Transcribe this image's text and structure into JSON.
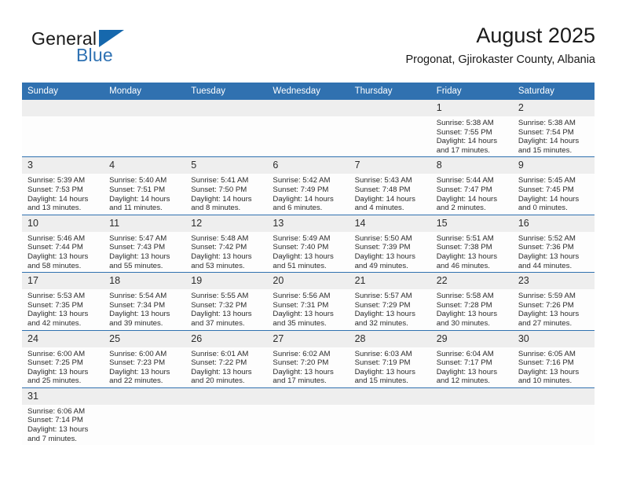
{
  "brand": {
    "name_part1": "General",
    "name_part2": "Blue",
    "logo_icon": "triangle-logo-icon"
  },
  "header": {
    "title": "August 2025",
    "subtitle": "Progonat, Gjirokaster County, Albania"
  },
  "colors": {
    "header_blue": "#3071b0",
    "brand_blue": "#2f72b3",
    "daynum_bg": "#eeeeee",
    "cell_bg": "#fdfdfd",
    "text": "#2b2b2b"
  },
  "weekday_headers": [
    "Sunday",
    "Monday",
    "Tuesday",
    "Wednesday",
    "Thursday",
    "Friday",
    "Saturday"
  ],
  "weeks": [
    [
      {
        "day": "",
        "blank": true,
        "sunrise": "",
        "sunset": "",
        "daylight_line1": "",
        "daylight_line2": ""
      },
      {
        "day": "",
        "blank": true,
        "sunrise": "",
        "sunset": "",
        "daylight_line1": "",
        "daylight_line2": ""
      },
      {
        "day": "",
        "blank": true,
        "sunrise": "",
        "sunset": "",
        "daylight_line1": "",
        "daylight_line2": ""
      },
      {
        "day": "",
        "blank": true,
        "sunrise": "",
        "sunset": "",
        "daylight_line1": "",
        "daylight_line2": ""
      },
      {
        "day": "",
        "blank": true,
        "sunrise": "",
        "sunset": "",
        "daylight_line1": "",
        "daylight_line2": ""
      },
      {
        "day": "1",
        "sunrise": "Sunrise: 5:38 AM",
        "sunset": "Sunset: 7:55 PM",
        "daylight_line1": "Daylight: 14 hours",
        "daylight_line2": "and 17 minutes."
      },
      {
        "day": "2",
        "sunrise": "Sunrise: 5:38 AM",
        "sunset": "Sunset: 7:54 PM",
        "daylight_line1": "Daylight: 14 hours",
        "daylight_line2": "and 15 minutes."
      }
    ],
    [
      {
        "day": "3",
        "sunrise": "Sunrise: 5:39 AM",
        "sunset": "Sunset: 7:53 PM",
        "daylight_line1": "Daylight: 14 hours",
        "daylight_line2": "and 13 minutes."
      },
      {
        "day": "4",
        "sunrise": "Sunrise: 5:40 AM",
        "sunset": "Sunset: 7:51 PM",
        "daylight_line1": "Daylight: 14 hours",
        "daylight_line2": "and 11 minutes."
      },
      {
        "day": "5",
        "sunrise": "Sunrise: 5:41 AM",
        "sunset": "Sunset: 7:50 PM",
        "daylight_line1": "Daylight: 14 hours",
        "daylight_line2": "and 8 minutes."
      },
      {
        "day": "6",
        "sunrise": "Sunrise: 5:42 AM",
        "sunset": "Sunset: 7:49 PM",
        "daylight_line1": "Daylight: 14 hours",
        "daylight_line2": "and 6 minutes."
      },
      {
        "day": "7",
        "sunrise": "Sunrise: 5:43 AM",
        "sunset": "Sunset: 7:48 PM",
        "daylight_line1": "Daylight: 14 hours",
        "daylight_line2": "and 4 minutes."
      },
      {
        "day": "8",
        "sunrise": "Sunrise: 5:44 AM",
        "sunset": "Sunset: 7:47 PM",
        "daylight_line1": "Daylight: 14 hours",
        "daylight_line2": "and 2 minutes."
      },
      {
        "day": "9",
        "sunrise": "Sunrise: 5:45 AM",
        "sunset": "Sunset: 7:45 PM",
        "daylight_line1": "Daylight: 14 hours",
        "daylight_line2": "and 0 minutes."
      }
    ],
    [
      {
        "day": "10",
        "sunrise": "Sunrise: 5:46 AM",
        "sunset": "Sunset: 7:44 PM",
        "daylight_line1": "Daylight: 13 hours",
        "daylight_line2": "and 58 minutes."
      },
      {
        "day": "11",
        "sunrise": "Sunrise: 5:47 AM",
        "sunset": "Sunset: 7:43 PM",
        "daylight_line1": "Daylight: 13 hours",
        "daylight_line2": "and 55 minutes."
      },
      {
        "day": "12",
        "sunrise": "Sunrise: 5:48 AM",
        "sunset": "Sunset: 7:42 PM",
        "daylight_line1": "Daylight: 13 hours",
        "daylight_line2": "and 53 minutes."
      },
      {
        "day": "13",
        "sunrise": "Sunrise: 5:49 AM",
        "sunset": "Sunset: 7:40 PM",
        "daylight_line1": "Daylight: 13 hours",
        "daylight_line2": "and 51 minutes."
      },
      {
        "day": "14",
        "sunrise": "Sunrise: 5:50 AM",
        "sunset": "Sunset: 7:39 PM",
        "daylight_line1": "Daylight: 13 hours",
        "daylight_line2": "and 49 minutes."
      },
      {
        "day": "15",
        "sunrise": "Sunrise: 5:51 AM",
        "sunset": "Sunset: 7:38 PM",
        "daylight_line1": "Daylight: 13 hours",
        "daylight_line2": "and 46 minutes."
      },
      {
        "day": "16",
        "sunrise": "Sunrise: 5:52 AM",
        "sunset": "Sunset: 7:36 PM",
        "daylight_line1": "Daylight: 13 hours",
        "daylight_line2": "and 44 minutes."
      }
    ],
    [
      {
        "day": "17",
        "sunrise": "Sunrise: 5:53 AM",
        "sunset": "Sunset: 7:35 PM",
        "daylight_line1": "Daylight: 13 hours",
        "daylight_line2": "and 42 minutes."
      },
      {
        "day": "18",
        "sunrise": "Sunrise: 5:54 AM",
        "sunset": "Sunset: 7:34 PM",
        "daylight_line1": "Daylight: 13 hours",
        "daylight_line2": "and 39 minutes."
      },
      {
        "day": "19",
        "sunrise": "Sunrise: 5:55 AM",
        "sunset": "Sunset: 7:32 PM",
        "daylight_line1": "Daylight: 13 hours",
        "daylight_line2": "and 37 minutes."
      },
      {
        "day": "20",
        "sunrise": "Sunrise: 5:56 AM",
        "sunset": "Sunset: 7:31 PM",
        "daylight_line1": "Daylight: 13 hours",
        "daylight_line2": "and 35 minutes."
      },
      {
        "day": "21",
        "sunrise": "Sunrise: 5:57 AM",
        "sunset": "Sunset: 7:29 PM",
        "daylight_line1": "Daylight: 13 hours",
        "daylight_line2": "and 32 minutes."
      },
      {
        "day": "22",
        "sunrise": "Sunrise: 5:58 AM",
        "sunset": "Sunset: 7:28 PM",
        "daylight_line1": "Daylight: 13 hours",
        "daylight_line2": "and 30 minutes."
      },
      {
        "day": "23",
        "sunrise": "Sunrise: 5:59 AM",
        "sunset": "Sunset: 7:26 PM",
        "daylight_line1": "Daylight: 13 hours",
        "daylight_line2": "and 27 minutes."
      }
    ],
    [
      {
        "day": "24",
        "sunrise": "Sunrise: 6:00 AM",
        "sunset": "Sunset: 7:25 PM",
        "daylight_line1": "Daylight: 13 hours",
        "daylight_line2": "and 25 minutes."
      },
      {
        "day": "25",
        "sunrise": "Sunrise: 6:00 AM",
        "sunset": "Sunset: 7:23 PM",
        "daylight_line1": "Daylight: 13 hours",
        "daylight_line2": "and 22 minutes."
      },
      {
        "day": "26",
        "sunrise": "Sunrise: 6:01 AM",
        "sunset": "Sunset: 7:22 PM",
        "daylight_line1": "Daylight: 13 hours",
        "daylight_line2": "and 20 minutes."
      },
      {
        "day": "27",
        "sunrise": "Sunrise: 6:02 AM",
        "sunset": "Sunset: 7:20 PM",
        "daylight_line1": "Daylight: 13 hours",
        "daylight_line2": "and 17 minutes."
      },
      {
        "day": "28",
        "sunrise": "Sunrise: 6:03 AM",
        "sunset": "Sunset: 7:19 PM",
        "daylight_line1": "Daylight: 13 hours",
        "daylight_line2": "and 15 minutes."
      },
      {
        "day": "29",
        "sunrise": "Sunrise: 6:04 AM",
        "sunset": "Sunset: 7:17 PM",
        "daylight_line1": "Daylight: 13 hours",
        "daylight_line2": "and 12 minutes."
      },
      {
        "day": "30",
        "sunrise": "Sunrise: 6:05 AM",
        "sunset": "Sunset: 7:16 PM",
        "daylight_line1": "Daylight: 13 hours",
        "daylight_line2": "and 10 minutes."
      }
    ],
    [
      {
        "day": "31",
        "sunrise": "Sunrise: 6:06 AM",
        "sunset": "Sunset: 7:14 PM",
        "daylight_line1": "Daylight: 13 hours",
        "daylight_line2": "and 7 minutes."
      },
      {
        "day": "",
        "blank": true,
        "sunrise": "",
        "sunset": "",
        "daylight_line1": "",
        "daylight_line2": ""
      },
      {
        "day": "",
        "blank": true,
        "sunrise": "",
        "sunset": "",
        "daylight_line1": "",
        "daylight_line2": ""
      },
      {
        "day": "",
        "blank": true,
        "sunrise": "",
        "sunset": "",
        "daylight_line1": "",
        "daylight_line2": ""
      },
      {
        "day": "",
        "blank": true,
        "sunrise": "",
        "sunset": "",
        "daylight_line1": "",
        "daylight_line2": ""
      },
      {
        "day": "",
        "blank": true,
        "sunrise": "",
        "sunset": "",
        "daylight_line1": "",
        "daylight_line2": ""
      },
      {
        "day": "",
        "blank": true,
        "sunrise": "",
        "sunset": "",
        "daylight_line1": "",
        "daylight_line2": ""
      }
    ]
  ]
}
